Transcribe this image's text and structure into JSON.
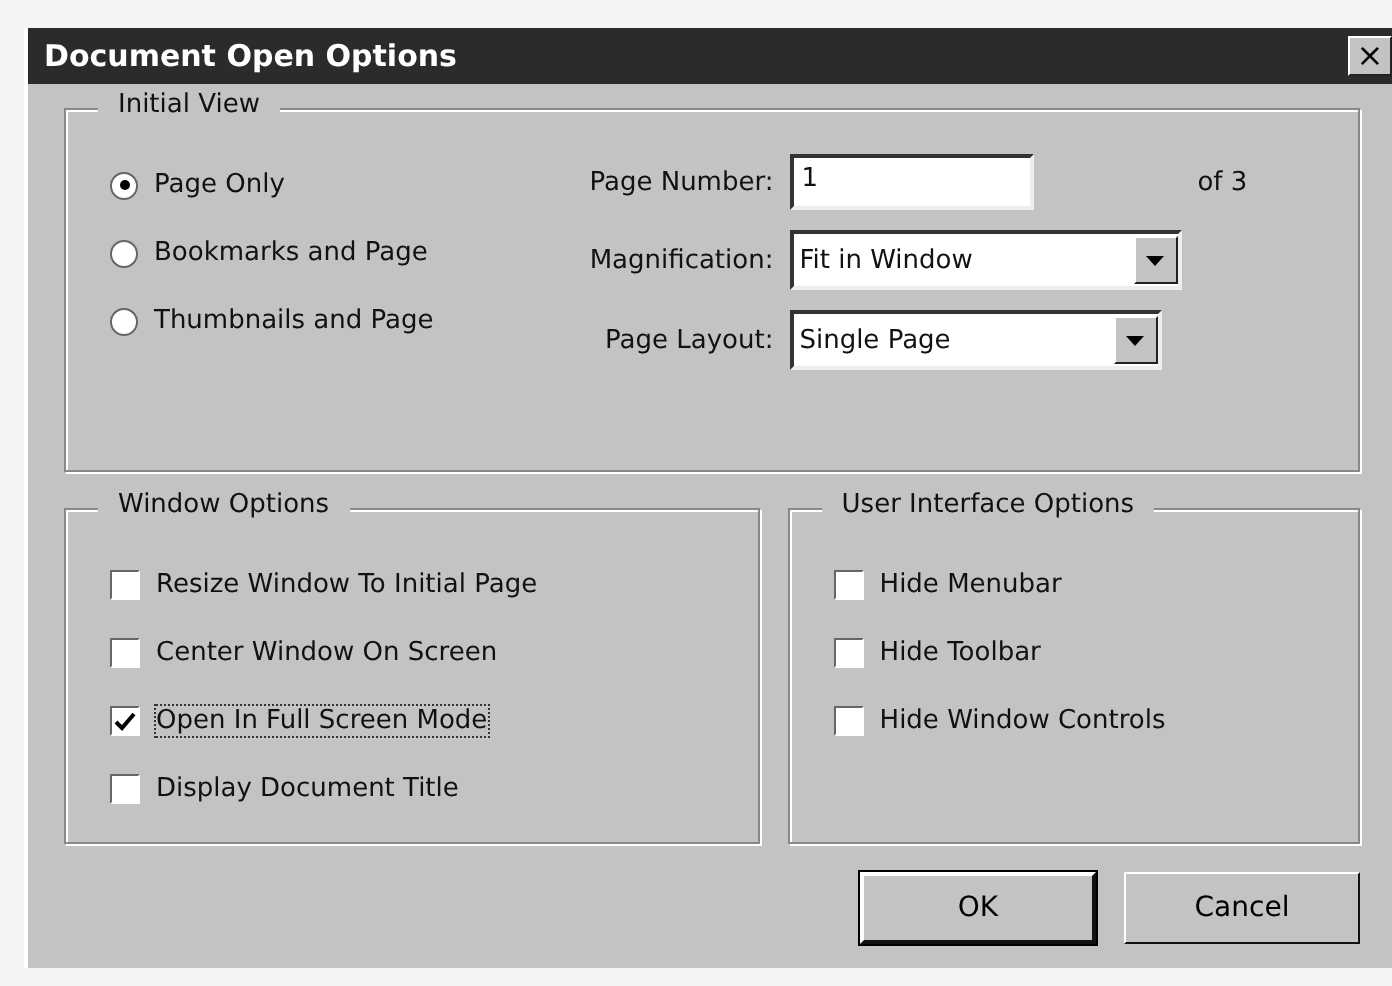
{
  "window": {
    "title": "Document Open Options",
    "close": "×"
  },
  "initial_view": {
    "title": "Initial View",
    "views": [
      {
        "label": "Page Only",
        "selected": true
      },
      {
        "label": "Bookmarks and Page",
        "selected": false
      },
      {
        "label": "Thumbnails and Page",
        "selected": false
      }
    ],
    "page_number": {
      "label": "Page Number:",
      "value": "1",
      "suffix": "of 3"
    },
    "magnification": {
      "label": "Magnification:",
      "value": "Fit in Window"
    },
    "page_layout": {
      "label": "Page Layout:",
      "value": "Single Page"
    }
  },
  "window_options": {
    "title": "Window Options",
    "items": [
      {
        "label": "Resize Window To Initial Page",
        "checked": false,
        "focused": false
      },
      {
        "label": "Center Window On Screen",
        "checked": false,
        "focused": false
      },
      {
        "label": "Open In Full Screen Mode",
        "checked": true,
        "focused": true
      },
      {
        "label": "Display Document Title",
        "checked": false,
        "focused": false
      }
    ]
  },
  "ui_options": {
    "title": "User Interface Options",
    "items": [
      {
        "label": "Hide Menubar",
        "checked": false,
        "focused": false
      },
      {
        "label": "Hide Toolbar",
        "checked": false,
        "focused": false
      },
      {
        "label": "Hide Window Controls",
        "checked": false,
        "focused": false
      }
    ]
  },
  "buttons": [
    "OK",
    "Cancel"
  ]
}
